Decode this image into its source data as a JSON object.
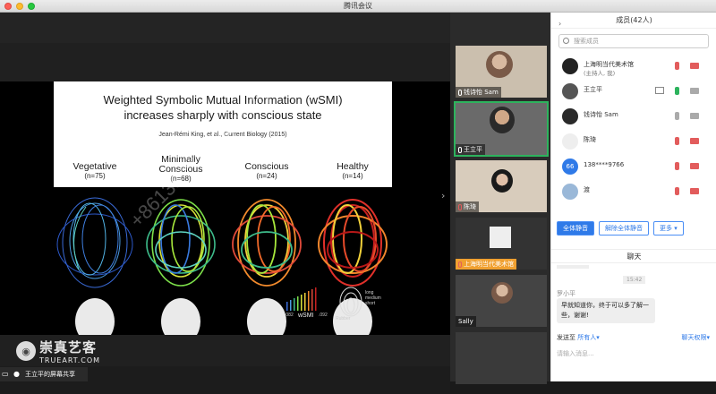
{
  "window": {
    "title": "腾讯会议"
  },
  "slide": {
    "title_line1": "Weighted Symbolic Mutual Information (wSMI)",
    "title_line2": "increases sharply with conscious state",
    "citation": "Jean-Rémi King, et al., Current Biology (2015)",
    "categories": [
      {
        "label": "Vegetative",
        "n": "(n=75)"
      },
      {
        "label": "Minimally Conscious",
        "n": "(n=68)"
      },
      {
        "label": "Conscious",
        "n": "(n=24)"
      },
      {
        "label": "Healthy",
        "n": "(n=14)"
      }
    ],
    "legend_min": ".082",
    "legend_max": ".092",
    "legend_label": "wSMI",
    "distance_labels": [
      "long",
      "medium",
      "short"
    ],
    "distance_sub": "Rubber",
    "watermark": "+86138****9766 Sally"
  },
  "share_indicator": {
    "label": "王立平的屏幕共享"
  },
  "logo": {
    "text1": "崇真艺客",
    "text2": "TRUEART.COM"
  },
  "thumbs": [
    {
      "name": "钱诗怡 Sam"
    },
    {
      "name": "王立平"
    },
    {
      "name": "陈琦"
    },
    {
      "name": "上海明当代美术馆"
    },
    {
      "name": "Sally"
    }
  ],
  "panel": {
    "members_title": "成员(42人)",
    "search_placeholder": "搜索成员",
    "members": [
      {
        "name": "上海明当代美术馆",
        "sub": "(主持人, 我)",
        "mic": "off",
        "cam": "off"
      },
      {
        "name": "王立平",
        "sub": "",
        "mic": "on",
        "cam": "on"
      },
      {
        "name": "钱诗怡 Sam",
        "sub": "",
        "mic": "normal",
        "cam": "on"
      },
      {
        "name": "陈琦",
        "sub": "",
        "mic": "off",
        "cam": "off"
      },
      {
        "name": "138****9766",
        "sub": "",
        "mic": "off",
        "cam": "off",
        "avatar_text": "66"
      },
      {
        "name": "渡",
        "sub": "",
        "mic": "off",
        "cam": "off"
      }
    ],
    "buttons": {
      "mute_all": "全体静音",
      "unmute_all": "解除全体静音",
      "more": "更多"
    },
    "chat_title": "聊天",
    "chat_time": "15:42",
    "chat_sender": "罗小平",
    "chat_message": "早就知道你，终于可以多了解一些，谢谢!",
    "send_to_label": "发送至",
    "send_to_value": "所有人",
    "chat_permission": "聊天权限",
    "input_placeholder": "请输入消息..."
  }
}
